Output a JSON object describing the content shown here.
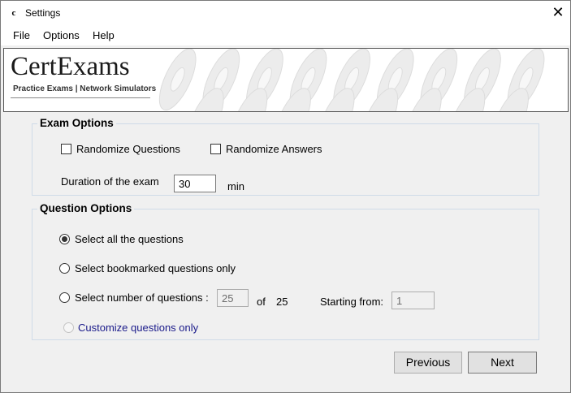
{
  "window": {
    "icon_glyph": "c",
    "title": "Settings",
    "close_glyph": "✕"
  },
  "menu": {
    "items": [
      "File",
      "Options",
      "Help"
    ]
  },
  "banner": {
    "logo": "CertExams",
    "tagline": "Practice Exams | Network Simulators"
  },
  "exam_options": {
    "title": "Exam Options",
    "randomize_questions_label": "Randomize Questions",
    "randomize_questions_checked": false,
    "randomize_answers_label": "Randomize Answers",
    "randomize_answers_checked": false,
    "duration_label": "Duration of the exam",
    "duration_value": "30",
    "duration_unit": "min"
  },
  "question_options": {
    "title": "Question Options",
    "select_all_label": "Select all the questions",
    "select_bookmarked_label": "Select bookmarked questions only",
    "select_number_label": "Select number of questions :",
    "number_value": "25",
    "of_label": "of",
    "total_questions": "25",
    "starting_from_label": "Starting from:",
    "starting_from_value": "1",
    "customize_label": "Customize questions only",
    "selected": "Select all the questions"
  },
  "buttons": {
    "previous": "Previous",
    "next": "Next"
  },
  "colors": {
    "group_border": "#cfdbe8",
    "customize_link": "#1a1a8a",
    "window_bg": "#f0f0f0"
  }
}
